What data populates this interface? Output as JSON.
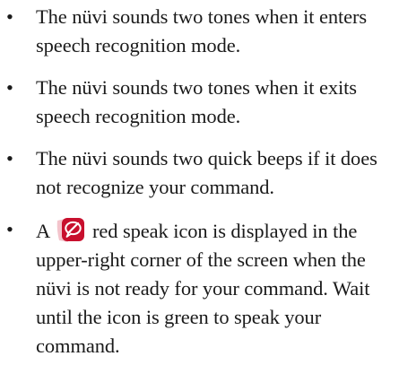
{
  "list": {
    "bullet_char": "•",
    "items": [
      {
        "text": "The nüvi sounds two tones when it enters speech recognition mode."
      },
      {
        "text": "The nüvi sounds two tones when it exits speech recognition mode."
      },
      {
        "text": "The nüvi sounds two quick beeps if it does not recognize your command."
      },
      {
        "before_icon": "A",
        "icon": "red-speak-icon",
        "after_icon": "red speak icon is displayed in the upper-right corner of the screen when the nüvi is not ready for your command. Wait until the icon is green to speak your command."
      }
    ]
  },
  "colors": {
    "text": "#1a1a1a",
    "icon_red": "#c8102e",
    "icon_pink": "#f3c4cc"
  }
}
